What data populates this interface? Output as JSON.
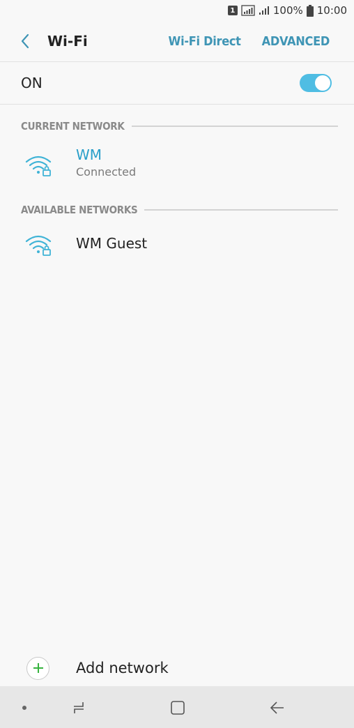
{
  "status_bar": {
    "sim_number": "1",
    "battery_percent": "100%",
    "time": "10:00"
  },
  "header": {
    "title": "Wi-Fi",
    "actions": [
      "Wi-Fi Direct",
      "ADVANCED"
    ]
  },
  "wifi_toggle": {
    "label": "ON",
    "state": true,
    "accent_color": "#4fbde3"
  },
  "current_network": {
    "section_title": "CURRENT NETWORK",
    "name": "WM",
    "status": "Connected",
    "icon": "wifi-lock-icon"
  },
  "available_networks": {
    "section_title": "AVAILABLE NETWORKS",
    "items": [
      {
        "name": "WM Guest",
        "icon": "wifi-lock-icon"
      }
    ]
  },
  "add_network": {
    "label": "Add network",
    "icon": "plus-icon"
  },
  "nav_bar": {
    "buttons": [
      "dot-icon",
      "recents-icon",
      "home-icon",
      "back-icon"
    ]
  }
}
